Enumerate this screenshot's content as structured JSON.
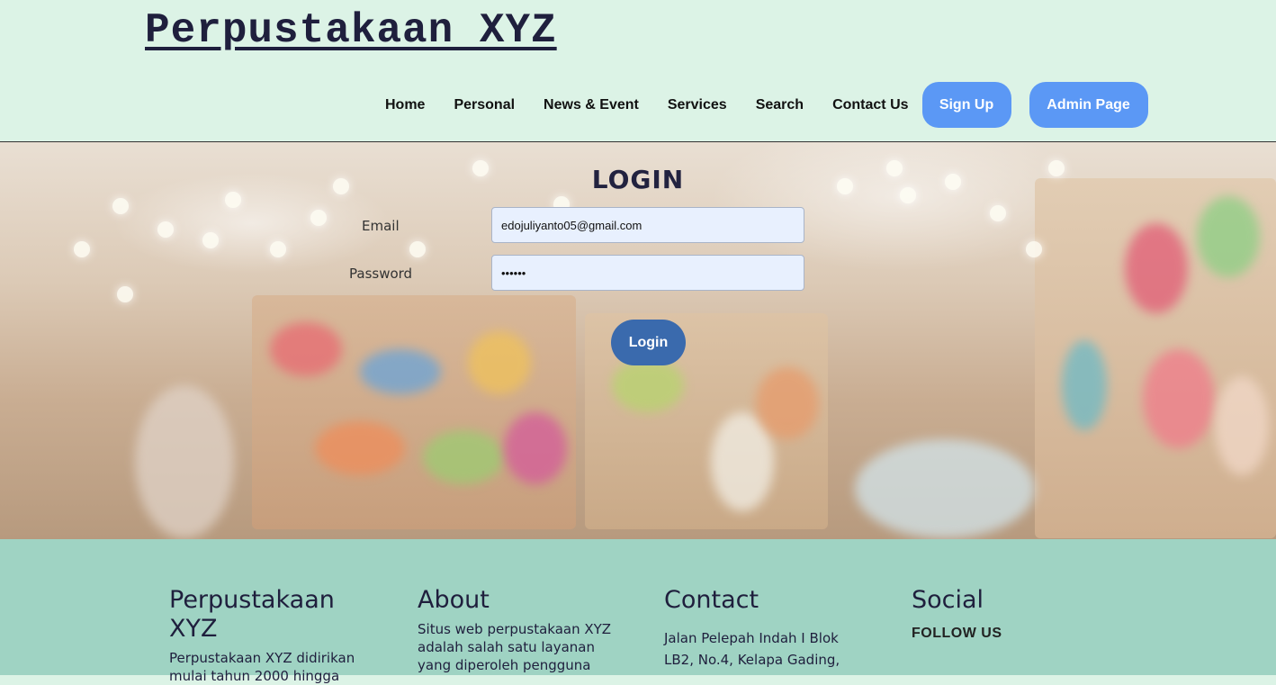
{
  "header": {
    "site_title": "Perpustakaan XYZ",
    "nav": [
      "Home",
      "Personal",
      "News & Event",
      "Services",
      "Search",
      "Contact Us"
    ],
    "signup_label": "Sign Up",
    "admin_label": "Admin Page"
  },
  "login": {
    "title": "LOGIN",
    "email_label": "Email",
    "email_value": "edojuliyanto05@gmail.com",
    "password_label": "Password",
    "password_value": "••••••",
    "button_label": "Login"
  },
  "footer": {
    "col1": {
      "title": "Perpustakaan XYZ",
      "text": "Perpustakaan XYZ didirikan mulai tahun 2000 hingga"
    },
    "col2": {
      "title": "About",
      "text": "Situs web perpustakaan XYZ adalah salah satu layanan yang diperoleh pengguna"
    },
    "col3": {
      "title": "Contact",
      "text": "Jalan Pelepah Indah I Blok LB2, No.4, Kelapa Gading,"
    },
    "col4": {
      "title": "Social",
      "follow": "FOLLOW US"
    }
  },
  "colors": {
    "header_bg": "#dcf3e6",
    "pill": "#5b98f5",
    "login_button": "#3a6aad",
    "footer_bg": "#9fd3c3"
  }
}
